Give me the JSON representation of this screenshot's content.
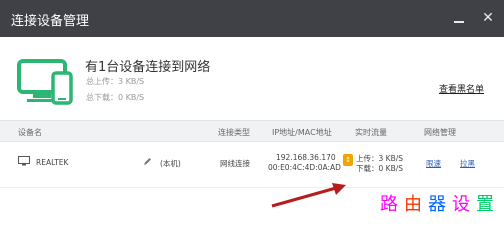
{
  "window": {
    "title": "连接设备管理",
    "close_glyph": "✕"
  },
  "summary": {
    "title": "有1台设备连接到网络",
    "upload": "总上传：3 KB/S",
    "download": "总下载：0 KB/S",
    "blacklist_link": "查看黑名单"
  },
  "table": {
    "headers": [
      "设备名",
      "连接类型",
      "IP地址/MAC地址",
      "实时流量",
      "网络管理"
    ],
    "rows": [
      {
        "device_name": "REALTEK",
        "this_device": "(本机)",
        "connection_type": "网线连接",
        "ip": "192.168.36.170",
        "mac": "00:E0:4C:4D:0A:AD",
        "upload": "上传：3 KB/S",
        "download": "下载：0 KB/S",
        "limit_label": "限速",
        "kick_label": "拉黑"
      }
    ]
  },
  "watermark": {
    "chars": [
      "路",
      "由",
      "器",
      "设",
      "置"
    ],
    "colors": [
      "#ff00ff",
      "#ff3300",
      "#0066ff",
      "#ff00ff",
      "#00cc66"
    ]
  },
  "colors": {
    "titlebar": "#3f4147",
    "accent_green": "#2bb673",
    "link_blue": "#2b5fb4",
    "arrow_red": "#b81d1d"
  }
}
